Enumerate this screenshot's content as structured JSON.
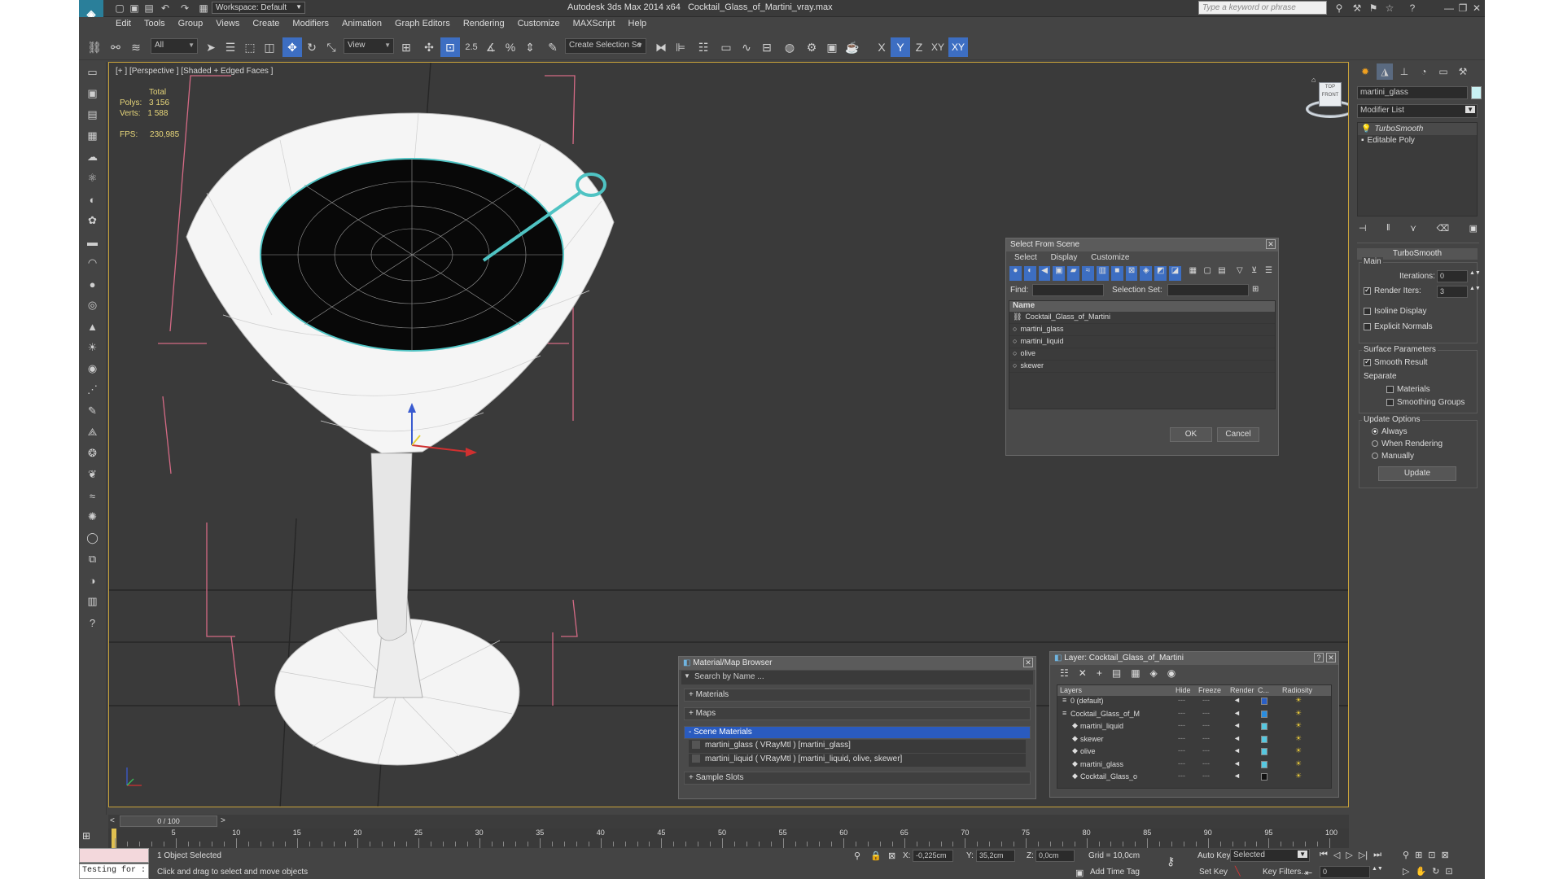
{
  "title": {
    "workspace": "Workspace: Default",
    "app": "Autodesk 3ds Max  2014 x64",
    "file": "Cocktail_Glass_of_Martini_vray.max",
    "search_placeholder": "Type a keyword or phrase"
  },
  "menu": [
    "Edit",
    "Tools",
    "Group",
    "Views",
    "Create",
    "Modifiers",
    "Animation",
    "Graph Editors",
    "Rendering",
    "Customize",
    "MAXScript",
    "Help"
  ],
  "toolbar": {
    "selection_filter": "All",
    "ref_coord": "View",
    "snap_value": "2.5",
    "selection_set_placeholder": "Create Selection Se",
    "axes": [
      "X",
      "Y",
      "Z",
      "XY",
      "XY"
    ]
  },
  "viewport": {
    "label": "[+ ] [Perspective ] [Shaded + Edged Faces ]",
    "stats": {
      "total_label": "Total",
      "polys_label": "Polys:",
      "polys": "3 156",
      "verts_label": "Verts:",
      "verts": "1 588",
      "fps_label": "FPS:",
      "fps": "230,985"
    },
    "viewcube_label": "FRONT",
    "viewcube_top": "TOP"
  },
  "command_panel": {
    "object_name": "martini_glass",
    "modifier_list": "Modifier List",
    "stack": [
      "TurboSmooth",
      "Editable Poly"
    ],
    "rollout_title": "TurboSmooth",
    "main_label": "Main",
    "iterations_label": "Iterations:",
    "iterations": "0",
    "render_iters_label": "Render Iters:",
    "render_iters": "3",
    "isoline_display": "Isoline Display",
    "explicit_normals": "Explicit Normals",
    "surface_params": "Surface Parameters",
    "smooth_result": "Smooth Result",
    "separate": "Separate",
    "materials": "Materials",
    "smoothing_groups": "Smoothing Groups",
    "update_options": "Update Options",
    "always": "Always",
    "when_rendering": "When Rendering",
    "manually": "Manually",
    "update_btn": "Update"
  },
  "select_dialog": {
    "title": "Select From Scene",
    "menus": [
      "Select",
      "Display",
      "Customize"
    ],
    "find_label": "Find:",
    "selection_set_label": "Selection Set:",
    "column_name": "Name",
    "items": [
      "Cocktail_Glass_of_Martini",
      "martini_glass",
      "martini_liquid",
      "olive",
      "skewer"
    ],
    "ok": "OK",
    "cancel": "Cancel"
  },
  "material_browser": {
    "title": "Material/Map Browser",
    "search_placeholder": "Search by Name ...",
    "groups": [
      "+ Materials",
      "+ Maps",
      "- Scene Materials",
      "+ Sample Slots"
    ],
    "scene_materials": [
      "martini_glass  ( VRayMtl ) [martini_glass]",
      "martini_liquid  ( VRayMtl ) [martini_liquid, olive, skewer]"
    ]
  },
  "layer_dialog": {
    "title": "Layer: Cocktail_Glass_of_Martini",
    "columns": [
      "Layers",
      "Hide",
      "Freeze",
      "Render",
      "C...",
      "Radiosity"
    ],
    "rows": [
      {
        "name": "0 (default)",
        "indent": 0,
        "color": "#2a5fc6"
      },
      {
        "name": "Cocktail_Glass_of_M",
        "indent": 0,
        "color": "#2a8ee0"
      },
      {
        "name": "martini_liquid",
        "indent": 1,
        "color": "#56c8e0"
      },
      {
        "name": "skewer",
        "indent": 1,
        "color": "#56c8e0"
      },
      {
        "name": "olive",
        "indent": 1,
        "color": "#56c8e0"
      },
      {
        "name": "martini_glass",
        "indent": 1,
        "color": "#56c8e0"
      },
      {
        "name": "Cocktail_Glass_o",
        "indent": 1,
        "color": "#111111"
      }
    ]
  },
  "timeline": {
    "frame": "0 / 100",
    "ticks": [
      "5",
      "10",
      "15",
      "20",
      "25",
      "30",
      "35",
      "40",
      "45",
      "50",
      "55",
      "60",
      "65",
      "70",
      "75",
      "80",
      "85",
      "90",
      "95",
      "100"
    ]
  },
  "status": {
    "listener": "Testing for :",
    "selected": "1 Object Selected",
    "prompt": "Click and drag to select and move objects",
    "x_label": "X:",
    "x": "-0,225cm",
    "y_label": "Y:",
    "y": "35,2cm",
    "z_label": "Z:",
    "z": "0,0cm",
    "grid": "Grid = 10,0cm",
    "add_time_tag": "Add Time Tag",
    "auto_key": "Auto Key",
    "set_key": "Set Key",
    "key_mode": "Selected",
    "key_filters": "Key Filters...",
    "frame_field": "0"
  }
}
